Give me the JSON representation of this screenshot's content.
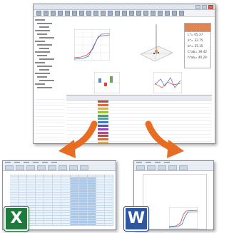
{
  "main_window": {
    "result_readouts": [
      "L*= 65.37",
      "a*= 32.75",
      "b*= 25.15",
      "C*ab= 39.42",
      "h*ab= 40.29"
    ],
    "result_swatch_color": "#e38550"
  },
  "colors": {
    "arrow_orange": "#e66d22",
    "excel_green": "#1e7b3c",
    "word_blue": "#2b57a3"
  },
  "excel": {
    "logo_letter": "X"
  },
  "word": {
    "logo_letter": "W"
  }
}
